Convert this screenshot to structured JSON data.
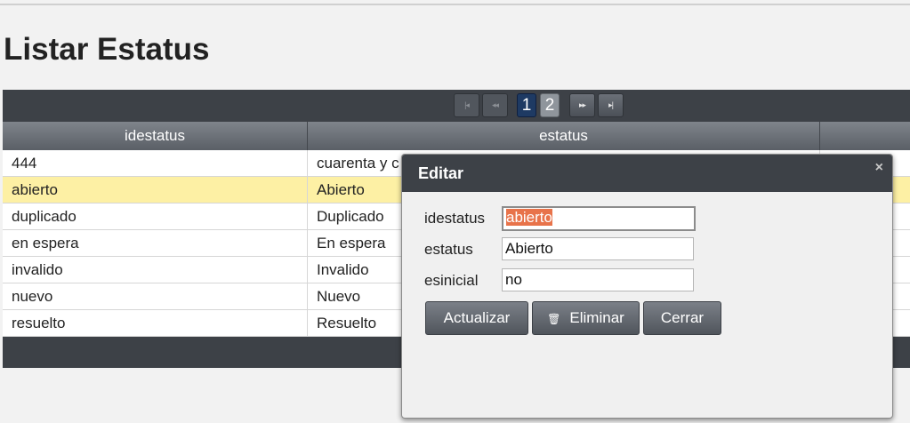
{
  "page": {
    "title": "Listar Estatus"
  },
  "pager": {
    "first": "|◂",
    "prev": "◂◂",
    "pages": [
      "1",
      "2"
    ],
    "current_page": 1,
    "next": "▸▸",
    "last": "▸|"
  },
  "table": {
    "columns": [
      "idestatus",
      "estatus",
      ""
    ],
    "rows": [
      {
        "idestatus": "444",
        "estatus": "cuarenta y c"
      },
      {
        "idestatus": "abierto",
        "estatus": "Abierto",
        "selected": true
      },
      {
        "idestatus": "duplicado",
        "estatus": "Duplicado"
      },
      {
        "idestatus": "en espera",
        "estatus": "En espera"
      },
      {
        "idestatus": "invalido",
        "estatus": "Invalido"
      },
      {
        "idestatus": "nuevo",
        "estatus": "Nuevo"
      },
      {
        "idestatus": "resuelto",
        "estatus": "Resuelto"
      }
    ]
  },
  "dialog": {
    "title": "Editar",
    "close": "×",
    "fields": {
      "idestatus": {
        "label": "idestatus",
        "value": "abierto"
      },
      "estatus": {
        "label": "estatus",
        "value": "Abierto"
      },
      "esinicial": {
        "label": "esinicial",
        "value": "no"
      }
    },
    "buttons": {
      "update": "Actualizar",
      "delete": "Eliminar",
      "close": "Cerrar"
    }
  },
  "colors": {
    "header": "#3d4147",
    "selected_row": "#fdf0a4",
    "text_selection": "#e8734a",
    "current_page": "#1e3a63"
  }
}
